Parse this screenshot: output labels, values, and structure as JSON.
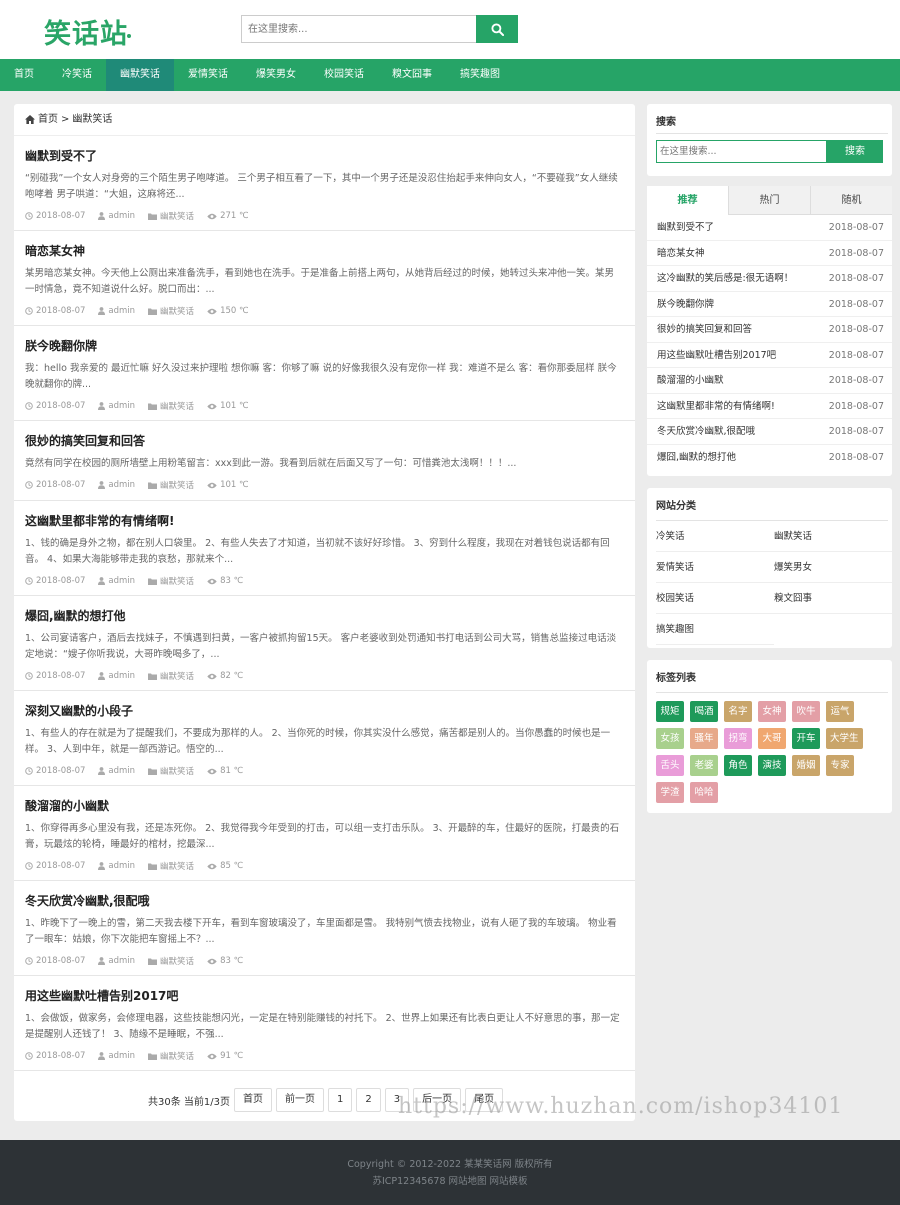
{
  "header": {
    "logo": "笑话站",
    "search_placeholder": "在这里搜索..."
  },
  "nav": [
    {
      "label": "首页",
      "active": false
    },
    {
      "label": "冷笑话",
      "active": false
    },
    {
      "label": "幽默笑话",
      "active": true
    },
    {
      "label": "爱情笑话",
      "active": false
    },
    {
      "label": "爆笑男女",
      "active": false
    },
    {
      "label": "校园笑话",
      "active": false
    },
    {
      "label": "糗文囧事",
      "active": false
    },
    {
      "label": "搞笑趣图",
      "active": false
    }
  ],
  "breadcrumb": {
    "home": "首页",
    "sep": ">",
    "current": "幽默笑话"
  },
  "articles": [
    {
      "title": "幽默到受不了",
      "summary": "“别碰我”一个女人对身旁的三个陌生男子咆哮道。 三个男子相互看了一下，其中一个男子还是没忍住抬起手来伸向女人，“不要碰我”女人继续咆哮着 男子哄道：“大姐，这麻将还...",
      "date": "2018-08-07",
      "author": "admin",
      "category": "幽默笑话",
      "views": "271 ℃"
    },
    {
      "title": "暗恋某女神",
      "summary": "某男暗恋某女神。今天他上公厕出来准备洗手，看到她也在洗手。于是准备上前搭上两句，从她背后经过的时候，她转过头来冲他一笑。某男一时情急，竟不知道说什么好。脱口而出：...",
      "date": "2018-08-07",
      "author": "admin",
      "category": "幽默笑话",
      "views": "150 ℃"
    },
    {
      "title": "朕今晚翻你牌",
      "summary": "我：hello 我亲爱的 最近忙嘛 好久没过来护理啦 想你嘛 客：你够了嘛 说的好像我很久没有宠你一样 我：难道不是么 客：看你那委屈样 朕今晚就翻你的牌...",
      "date": "2018-08-07",
      "author": "admin",
      "category": "幽默笑话",
      "views": "101 ℃"
    },
    {
      "title": "很妙的搞笑回复和回答",
      "summary": "竟然有同学在校园的厕所墙壁上用粉笔留言：xxx到此一游。我看到后就在后面又写了一句：可惜粪池太浅啊！！！...",
      "date": "2018-08-07",
      "author": "admin",
      "category": "幽默笑话",
      "views": "101 ℃"
    },
    {
      "title": "这幽默里都非常的有情绪啊!",
      "summary": "1、钱的确是身外之物，都在别人口袋里。 2、有些人失去了才知道，当初就不该好好珍惜。 3、穷到什么程度，我现在对着钱包说话都有回音。 4、如果大海能够带走我的哀愁，那就来个...",
      "date": "2018-08-07",
      "author": "admin",
      "category": "幽默笑话",
      "views": "83 ℃"
    },
    {
      "title": "爆囧,幽默的想打他",
      "summary": "1、公司宴请客户，酒后去找妹子，不慎遇到扫黄，一客户被抓拘留15天。 客户老婆收到处罚通知书打电话到公司大骂，销售总监接过电话淡定地说：“嫂子你听我说，大哥昨晚喝多了，...",
      "date": "2018-08-07",
      "author": "admin",
      "category": "幽默笑话",
      "views": "82 ℃"
    },
    {
      "title": "深刻又幽默的小段子",
      "summary": "1、有些人的存在就是为了提醒我们，不要成为那样的人。 2、当你死的时候，你其实没什么感觉，痛苦都是别人的。当你愚蠢的时候也是一样。 3、人到中年，就是一部西游记。悟空的...",
      "date": "2018-08-07",
      "author": "admin",
      "category": "幽默笑话",
      "views": "81 ℃"
    },
    {
      "title": "酸溜溜的小幽默",
      "summary": "1、你穿得再多心里没有我，还是冻死你。 2、我觉得我今年受到的打击，可以组一支打击乐队。 3、开最醉的车，住最好的医院，打最贵的石膏，玩最炫的轮椅，睡最好的棺材，挖最深...",
      "date": "2018-08-07",
      "author": "admin",
      "category": "幽默笑话",
      "views": "85 ℃"
    },
    {
      "title": "冬天欣赏冷幽默,很配哦",
      "summary": "1、昨晚下了一晚上的雪，第二天我去楼下开车，看到车窗玻璃没了，车里面都是雪。 我特别气愤去找物业，说有人砸了我的车玻璃。 物业看了一眼车：姑娘，你下次能把车窗摇上不？...",
      "date": "2018-08-07",
      "author": "admin",
      "category": "幽默笑话",
      "views": "83 ℃"
    },
    {
      "title": "用这些幽默吐槽告别2017吧",
      "summary": "1、会做饭，做家务，会修理电器，这些技能想闪光，一定是在特别能赚钱的衬托下。 2、世界上如果还有比表白更让人不好意思的事，那一定是提醒别人还钱了！ 3、随缘不是睡眠，不强...",
      "date": "2018-08-07",
      "author": "admin",
      "category": "幽默笑话",
      "views": "91 ℃"
    }
  ],
  "pager": {
    "info": "共30条 当前1/3页",
    "first": "首页",
    "prev": "前一页",
    "pages": [
      "1",
      "2",
      "3"
    ],
    "next": "后一页",
    "last": "尾页"
  },
  "sidebar": {
    "search": {
      "title": "搜索",
      "placeholder": "在这里搜索...",
      "button": "搜索"
    },
    "tabs": [
      "推荐",
      "热门",
      "随机"
    ],
    "ranking": [
      {
        "title": "幽默到受不了",
        "date": "2018-08-07"
      },
      {
        "title": "暗恋某女神",
        "date": "2018-08-07"
      },
      {
        "title": "这冷幽默的笑后感是:很无语啊！",
        "date": "2018-08-07"
      },
      {
        "title": "朕今晚翻你牌",
        "date": "2018-08-07"
      },
      {
        "title": "很妙的搞笑回复和回答",
        "date": "2018-08-07"
      },
      {
        "title": "用这些幽默吐槽告别2017吧",
        "date": "2018-08-07"
      },
      {
        "title": "酸溜溜的小幽默",
        "date": "2018-08-07"
      },
      {
        "title": "这幽默里都非常的有情绪啊!",
        "date": "2018-08-07"
      },
      {
        "title": "冬天欣赏冷幽默,很配哦",
        "date": "2018-08-07"
      },
      {
        "title": "爆囧,幽默的想打他",
        "date": "2018-08-07"
      }
    ],
    "categories": {
      "title": "网站分类",
      "items": [
        "冷笑话",
        "幽默笑话",
        "爱情笑话",
        "爆笑男女",
        "校园笑话",
        "糗文囧事",
        "搞笑趣图"
      ]
    },
    "tags": {
      "title": "标签列表",
      "items": [
        {
          "label": "规矩",
          "color": "#1e9a5a"
        },
        {
          "label": "喝酒",
          "color": "#1e9a5a"
        },
        {
          "label": "名字",
          "color": "#c9a56a"
        },
        {
          "label": "女神",
          "color": "#e39fa6"
        },
        {
          "label": "吹牛",
          "color": "#e39fa6"
        },
        {
          "label": "运气",
          "color": "#c9a56a"
        },
        {
          "label": "女孩",
          "color": "#a8d08d"
        },
        {
          "label": "骚年",
          "color": "#e7a98a"
        },
        {
          "label": "拐弯",
          "color": "#e99cd8"
        },
        {
          "label": "大哥",
          "color": "#f0a770"
        },
        {
          "label": "开车",
          "color": "#1e9a5a"
        },
        {
          "label": "大学生",
          "color": "#c9a56a"
        },
        {
          "label": "舌头",
          "color": "#e99cd8"
        },
        {
          "label": "老婆",
          "color": "#a8d08d"
        },
        {
          "label": "角色",
          "color": "#1e9a5a"
        },
        {
          "label": "演技",
          "color": "#1e9a5a"
        },
        {
          "label": "婚姻",
          "color": "#c9a56a"
        },
        {
          "label": "专家",
          "color": "#c9a56a"
        },
        {
          "label": "学渣",
          "color": "#e39fa6"
        },
        {
          "label": "哈哈",
          "color": "#e39fa6"
        }
      ]
    }
  },
  "footer": {
    "copyright": "Copyright © 2012-2022 某某笑话网 版权所有",
    "icp": "苏ICP12345678 网站地图 网站模板"
  },
  "watermark": "https://www.huzhan.com/ishop34101",
  "colors": {
    "accent": "#26a467",
    "nav_active": "#1f8a78",
    "footer_bg": "#2d3236"
  }
}
